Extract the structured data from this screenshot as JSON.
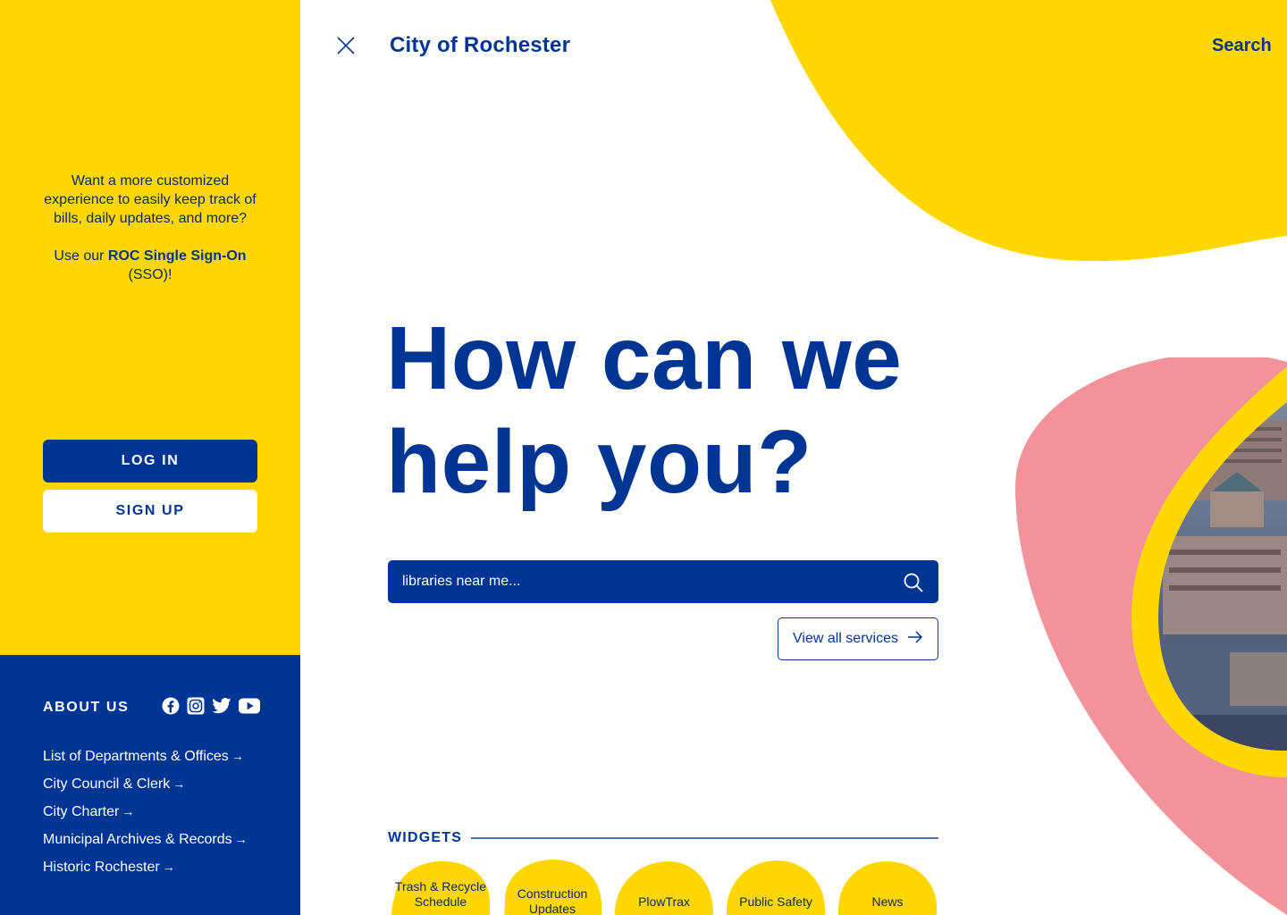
{
  "colors": {
    "brand_blue": "#003594",
    "brand_yellow": "#FFD700",
    "accent_pink": "#F2939C",
    "white": "#FFFFFF"
  },
  "sidebar": {
    "sso_intro": "Want a more customized experience to easily keep track of bills, daily updates, and more?",
    "sso_prefix": "Use our ",
    "sso_link": "ROC Single Sign-On",
    "sso_suffix": " (SSO)!",
    "login_label": "LOG IN",
    "signup_label": "SIGN UP",
    "about": {
      "title": "ABOUT US",
      "social_icons": [
        "facebook-icon",
        "instagram-icon",
        "twitter-icon",
        "youtube-icon"
      ],
      "links": [
        "List of Departments & Offices",
        "City Council & Clerk",
        "City Charter",
        "Municipal Archives & Records",
        "Historic Rochester"
      ],
      "link_arrow": "→"
    }
  },
  "header": {
    "title": "City of Rochester",
    "search_label": "Search",
    "close_icon": "close-icon"
  },
  "hero": {
    "line1": "How can we",
    "line2": "help you?"
  },
  "search": {
    "placeholder": "libraries near me...",
    "icon": "search-icon"
  },
  "view_all": {
    "label": "View all services",
    "icon": "arrow-right-icon"
  },
  "widgets": {
    "title": "WIDGETS",
    "items": [
      {
        "label": "Trash & Recycle Schedule"
      },
      {
        "label": "Construction Updates"
      },
      {
        "label": "PlowTrax"
      },
      {
        "label": "Public Safety"
      },
      {
        "label": "News"
      }
    ]
  }
}
